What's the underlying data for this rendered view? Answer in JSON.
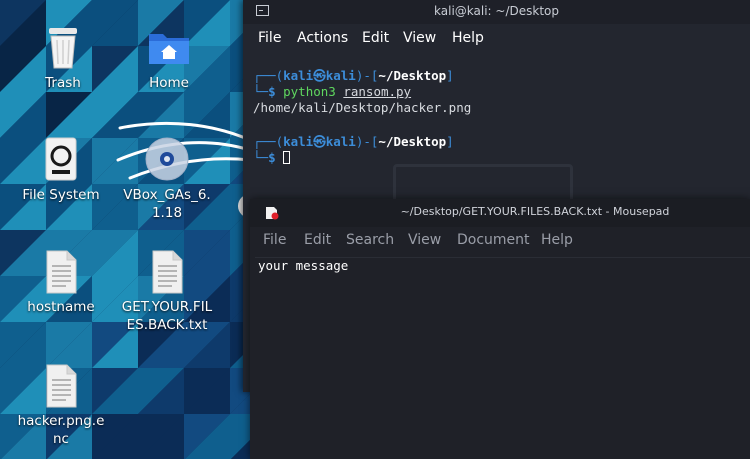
{
  "desktop": {
    "icons": [
      {
        "label": "Trash",
        "icon": "trash-icon"
      },
      {
        "label": "Home",
        "icon": "home-folder-icon"
      },
      {
        "label": "File System",
        "icon": "drive-icon"
      },
      {
        "label": "VBox_GAs_6.1.18",
        "icon": "optical-disc-icon"
      },
      {
        "label": "hostname",
        "icon": "text-file-icon"
      },
      {
        "label": "GET.YOUR.FILES.BACK.txt",
        "icon": "text-file-icon"
      },
      {
        "label": "hacker.png.enc",
        "icon": "text-file-icon"
      }
    ]
  },
  "terminal": {
    "title": "kali@kali: ~/Desktop",
    "menu": [
      "File",
      "Actions",
      "Edit",
      "View",
      "Help"
    ],
    "prompt_user": "kali",
    "prompt_at": "㉿",
    "prompt_host": "kali",
    "prompt_dir": "~/Desktop",
    "prompt_symbol": "$",
    "command_name": "python3",
    "command_arg": "ransom.py",
    "output": "/home/kali/Desktop/hacker.png"
  },
  "mousepad": {
    "title": "~/Desktop/GET.YOUR.FILES.BACK.txt - Mousepad",
    "menu": [
      "File",
      "Edit",
      "Search",
      "View",
      "Document",
      "Help"
    ],
    "content": "your message"
  },
  "colors": {
    "prompt_blue": "#3c8dd9",
    "command_green": "#5fd75f",
    "terminal_bg": "#23262f",
    "editor_bg": "#1f2128"
  }
}
